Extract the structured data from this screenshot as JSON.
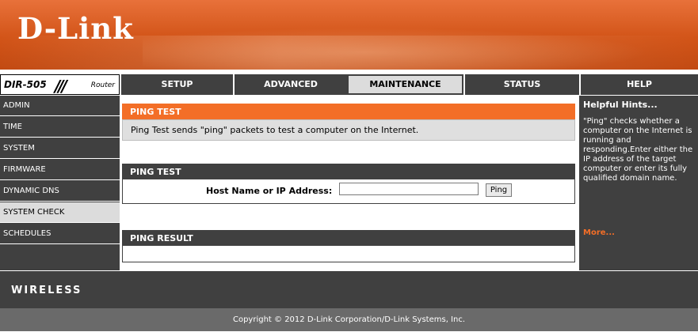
{
  "banner": {
    "logo": "D-Link"
  },
  "model": {
    "name": "DIR-505",
    "slashes": "///",
    "type": "Router"
  },
  "topnav": {
    "tabs": [
      {
        "label": "SETUP"
      },
      {
        "label": "ADVANCED"
      },
      {
        "label": "MAINTENANCE",
        "active": true
      },
      {
        "label": "STATUS"
      },
      {
        "label": "HELP"
      }
    ]
  },
  "sidebar": {
    "items": [
      {
        "label": "ADMIN"
      },
      {
        "label": "TIME"
      },
      {
        "label": "SYSTEM"
      },
      {
        "label": "FIRMWARE"
      },
      {
        "label": "DYNAMIC DNS"
      },
      {
        "label": "SYSTEM CHECK",
        "active": true
      },
      {
        "label": "SCHEDULES"
      }
    ]
  },
  "main": {
    "intro_title": "PING TEST",
    "intro_text": "Ping Test sends \"ping\" packets to test a computer on the Internet.",
    "ping_section_title": "PING TEST",
    "host_label": "Host Name or IP Address:",
    "host_value": "",
    "ping_button": "Ping",
    "result_title": "PING RESULT"
  },
  "hints": {
    "title": "Helpful Hints...",
    "text": "\"Ping\" checks whether a computer on the Internet is running and responding.Enter either the IP address of the target computer or enter its fully qualified domain name.",
    "more": "More..."
  },
  "wireless": {
    "label": "WIRELESS"
  },
  "footer": {
    "copyright": "Copyright © 2012 D-Link Corporation/D-Link Systems, Inc."
  },
  "colors": {
    "accent": "#f36e27",
    "dark": "#404040",
    "active_tab": "#dcdcdc"
  }
}
